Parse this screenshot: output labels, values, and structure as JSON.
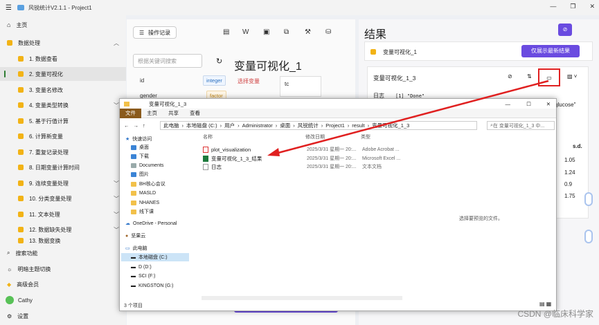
{
  "window": {
    "title": "风锐统计V2.1.1 - Project1",
    "buttons": [
      "—",
      "❐",
      "✕"
    ]
  },
  "sidebar": {
    "items": [
      {
        "label": "主页",
        "icon": "home-icon"
      },
      {
        "label": "数据处理",
        "icon": "folder-icon"
      },
      {
        "label": "1. 数据查看"
      },
      {
        "label": "2. 变量可视化"
      },
      {
        "label": "3. 变量名修改"
      },
      {
        "label": "4. 变量类型转换"
      },
      {
        "label": "5. 基于行值计算"
      },
      {
        "label": "6. 计算新变量"
      },
      {
        "label": "7. 重复记录处理"
      },
      {
        "label": "8. 日期变量计算时间"
      },
      {
        "label": "9. 连续变量处理"
      },
      {
        "label": "10. 分类变量处理"
      },
      {
        "label": "11. 文本处理"
      },
      {
        "label": "12. 数据缺失处理"
      },
      {
        "label": "13. 数据变换"
      }
    ],
    "bottom": [
      {
        "label": "搜索功能"
      },
      {
        "label": "明暗主题切换"
      },
      {
        "label": "高级会员"
      },
      {
        "label": "Cathy"
      },
      {
        "label": "设置"
      }
    ]
  },
  "main": {
    "toolbar_record": "操作记录",
    "search_placeholder": "根据关键词搜索",
    "variables": [
      {
        "name": "id",
        "type": "integer"
      },
      {
        "name": "gender",
        "type": "factor"
      }
    ],
    "heading": "变量可视化_1",
    "choose_var": "选择变量",
    "tc": "tc"
  },
  "result": {
    "title": "结果",
    "item_title": "变量可视化_1",
    "latest_btn": "仅展示最新结果",
    "card_title": "变量可视化_1_3",
    "log_label": "日志",
    "log_text": "[1] \"Done\"",
    "glucose_text": "glucose\"",
    "sd_header": "s.d.",
    "sd_values": [
      "1.05",
      "1.24",
      "0.9",
      "1.75"
    ]
  },
  "explorer": {
    "title": "变量可视化_1_3",
    "ribbon": [
      "文件",
      "主页",
      "共享",
      "查看"
    ],
    "path": [
      "此电脑",
      "本地磁盘 (C:)",
      "用户",
      "Administrator",
      "桌面",
      "风锐统计",
      "Project1",
      "result",
      "变量可视化_1_3"
    ],
    "search_placeholder": "在 变量可视化_1_3 中...",
    "nav": [
      {
        "label": "快速访问"
      },
      {
        "label": "桌面"
      },
      {
        "label": "下载"
      },
      {
        "label": "Documents"
      },
      {
        "label": "图片"
      },
      {
        "label": "BH核心会议"
      },
      {
        "label": "MASLD"
      },
      {
        "label": "NHANES"
      },
      {
        "label": "线下课"
      },
      {
        "label": "OneDrive - Personal"
      },
      {
        "label": "坚果云"
      },
      {
        "label": "此电脑"
      },
      {
        "label": "本地磁盘 (C:)"
      },
      {
        "label": "D (D:)"
      },
      {
        "label": "SCI (F:)"
      },
      {
        "label": "KINGSTON (G:)"
      }
    ],
    "headers": {
      "name": "名称",
      "date": "修改日期",
      "type": "类型"
    },
    "files": [
      {
        "name": "plot_visualization",
        "date": "2025/3/31 星期一 20:...",
        "type": "Adobe Acrobat ..."
      },
      {
        "name": "变量可视化_1_3_结果",
        "date": "2025/3/31 星期一 20:...",
        "type": "Microsoft Excel ..."
      },
      {
        "name": "日志",
        "date": "2025/3/31 星期一 20:...",
        "type": "文本文档"
      }
    ],
    "preview_text": "选择要预览的文件。",
    "status": "3 个项目"
  },
  "watermark": "CSDN @临床科学家"
}
